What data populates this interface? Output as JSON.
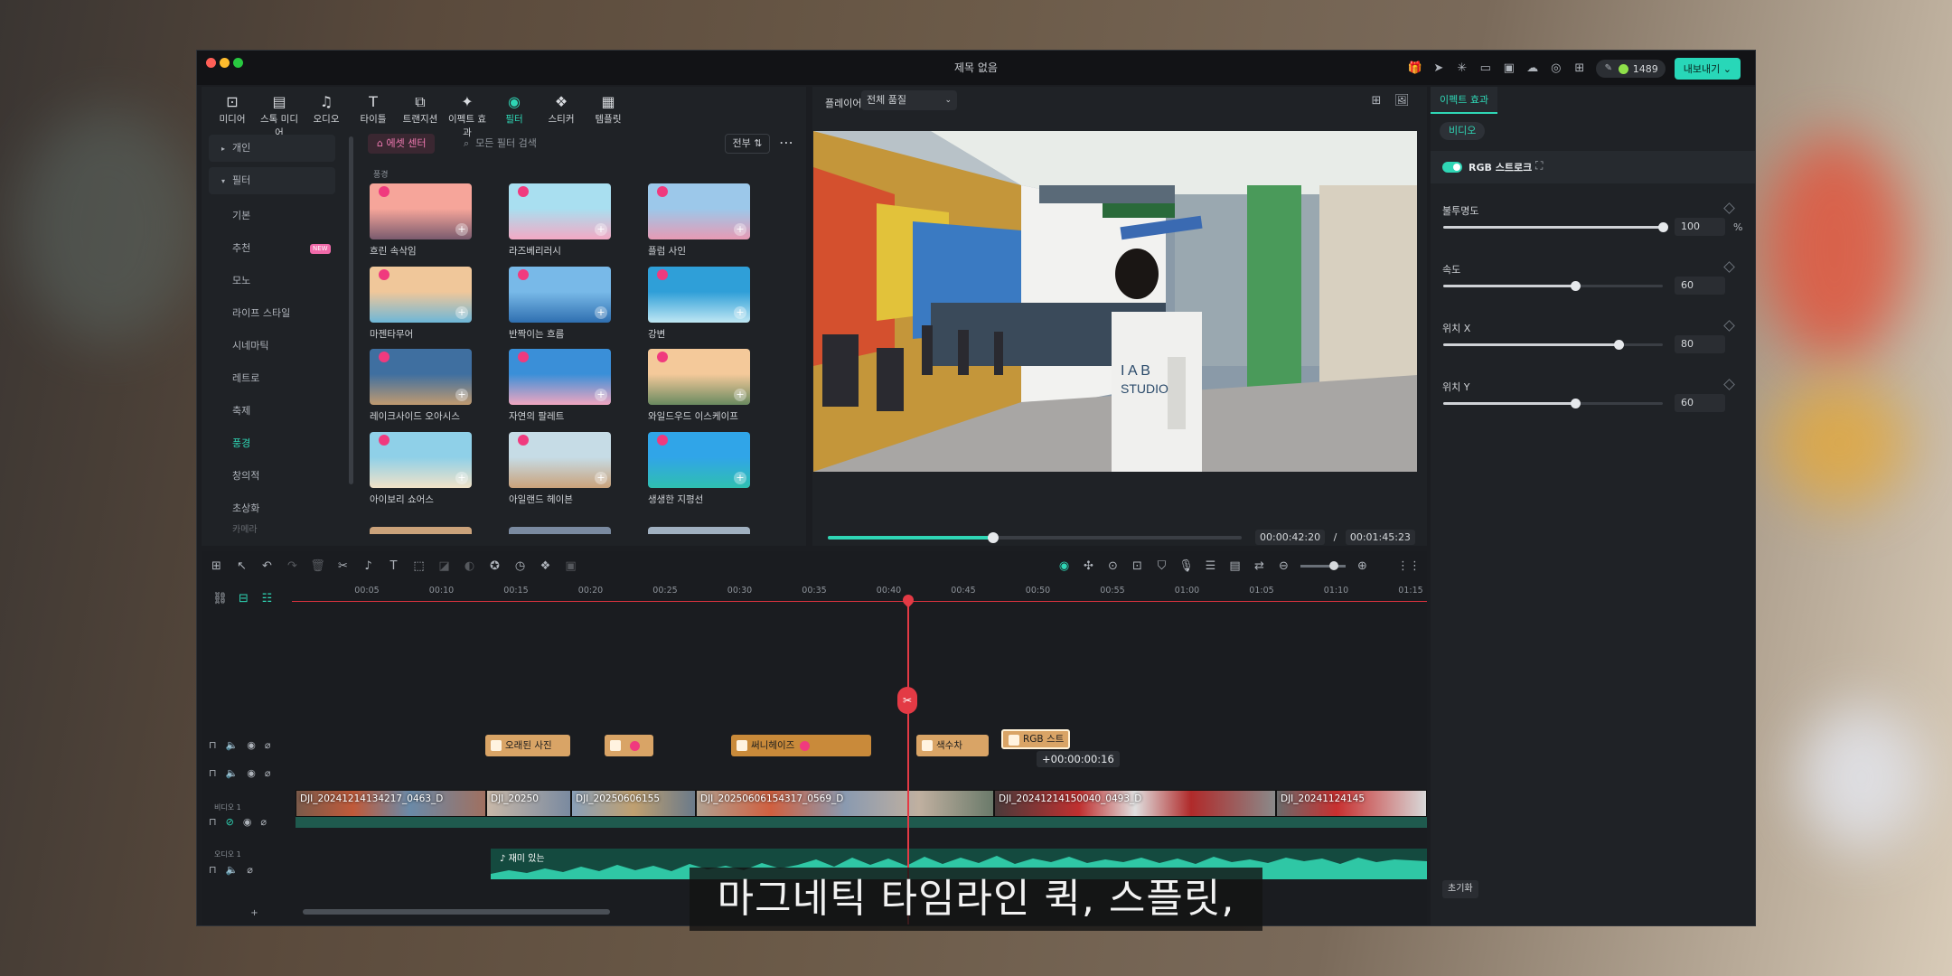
{
  "window": {
    "title": "제목 없음",
    "credits": "1489",
    "export_label": "내보내기"
  },
  "media_tabs": [
    {
      "label": "미디어",
      "icon": "media-icon"
    },
    {
      "label": "스톡 미디어",
      "icon": "stock-icon"
    },
    {
      "label": "오디오",
      "icon": "music-icon"
    },
    {
      "label": "타이틀",
      "icon": "title-icon"
    },
    {
      "label": "트랜지션",
      "icon": "transition-icon"
    },
    {
      "label": "이펙트 효과",
      "icon": "effects-icon"
    },
    {
      "label": "필터",
      "icon": "filter-icon",
      "active": true
    },
    {
      "label": "스티커",
      "icon": "sticker-icon"
    },
    {
      "label": "템플릿",
      "icon": "template-icon"
    }
  ],
  "categories": {
    "personal": "개인",
    "filter": "필터",
    "items": [
      "기본",
      "추천",
      "모노",
      "라이프 스타일",
      "시네마틱",
      "레트로",
      "축제",
      "풍경",
      "창의적",
      "초상화",
      "카메라"
    ],
    "new_badge": "NEW",
    "active": "풍경"
  },
  "search": {
    "asset_center": "에셋 센터",
    "placeholder": "모든 필터 검색",
    "all_label": "전부"
  },
  "section_title": "풍경",
  "filters": [
    {
      "label": "흐린 속삭임",
      "colors": [
        "#f6a59a",
        "#7a5b6e"
      ]
    },
    {
      "label": "라즈베리러시",
      "colors": [
        "#a9dff0",
        "#f3a9c4"
      ]
    },
    {
      "label": "플럼 사인",
      "colors": [
        "#9cc8ea",
        "#e79ab4"
      ]
    },
    {
      "label": "마젠타무어",
      "colors": [
        "#f0c79a",
        "#6db7d8"
      ]
    },
    {
      "label": "반짝이는 흐름",
      "colors": [
        "#78b9e8",
        "#2f6fb0"
      ]
    },
    {
      "label": "강변",
      "colors": [
        "#2f9fd8",
        "#bfe7f3"
      ]
    },
    {
      "label": "레이크사이드 오아시스",
      "colors": [
        "#3f6fa0",
        "#c09a70"
      ]
    },
    {
      "label": "자연의 팔레트",
      "colors": [
        "#3a8fd8",
        "#f0a6c0"
      ]
    },
    {
      "label": "와일드우드 이스케이프",
      "colors": [
        "#f4c99a",
        "#6a8a60"
      ]
    },
    {
      "label": "아이보리 쇼어스",
      "colors": [
        "#8fd0e8",
        "#f1e2c8"
      ]
    },
    {
      "label": "아일랜드 헤이븐",
      "colors": [
        "#c6dce6",
        "#caa27a"
      ]
    },
    {
      "label": "생생한 지평선",
      "colors": [
        "#30a5e8",
        "#2fbfb0"
      ]
    }
  ],
  "player": {
    "label": "플레이어",
    "quality": "전체 품질",
    "current_time": "00:00:42:20",
    "separator": "/",
    "total_time": "00:01:45:23",
    "progress": 0.4
  },
  "properties": {
    "tab": "이펙트 효과",
    "chip": "비디오",
    "effect_name": "RGB 스트로크",
    "params": [
      {
        "label": "불투명도",
        "value": "100",
        "unit": "%",
        "fraction": 1.0
      },
      {
        "label": "속도",
        "value": "60",
        "unit": "",
        "fraction": 0.6
      },
      {
        "label": "위치 X",
        "value": "80",
        "unit": "",
        "fraction": 0.8
      },
      {
        "label": "위치 Y",
        "value": "60",
        "unit": "",
        "fraction": 0.6
      }
    ],
    "reset": "초기화"
  },
  "timeline": {
    "ticks": [
      "00:05",
      "00:10",
      "00:15",
      "00:20",
      "00:25",
      "00:30",
      "00:35",
      "00:40",
      "00:45",
      "00:50",
      "00:55",
      "01:00",
      "01:05",
      "01:10",
      "01:15"
    ],
    "video_track_name": "비디오 1",
    "audio_track_name": "오디오 1",
    "effect_clips": [
      {
        "label": "오래된 사진",
        "gem": false
      },
      {
        "label": "",
        "gem": true
      },
      {
        "label": "써니헤이즈",
        "gem": true
      },
      {
        "label": "색수차",
        "gem": false
      },
      {
        "label": "RGB 스트",
        "gem": false
      }
    ],
    "offset_tooltip": "+00:00:00:16",
    "video_clips": [
      "DJI_20241214134217_0463_D",
      "DJI_20250",
      "DJI_20250606155",
      "DJI_20250606154317_0569_D",
      "DJI_20241214150040_0493_D",
      "DJI_20241124145"
    ],
    "audio_clip": "재미 있는"
  },
  "subtitle": "마그네틱 타임라인 퀵, 스플릿,"
}
